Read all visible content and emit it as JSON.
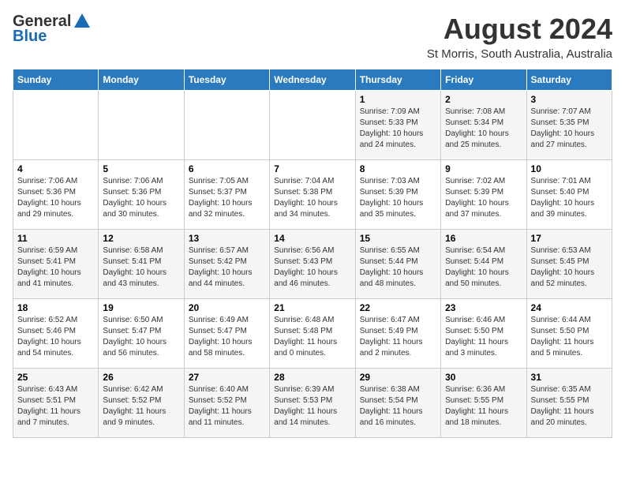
{
  "header": {
    "logo_general": "General",
    "logo_blue": "Blue",
    "month_year": "August 2024",
    "location": "St Morris, South Australia, Australia"
  },
  "days_of_week": [
    "Sunday",
    "Monday",
    "Tuesday",
    "Wednesday",
    "Thursday",
    "Friday",
    "Saturday"
  ],
  "weeks": [
    [
      {
        "day": "",
        "detail": ""
      },
      {
        "day": "",
        "detail": ""
      },
      {
        "day": "",
        "detail": ""
      },
      {
        "day": "",
        "detail": ""
      },
      {
        "day": "1",
        "detail": "Sunrise: 7:09 AM\nSunset: 5:33 PM\nDaylight: 10 hours\nand 24 minutes."
      },
      {
        "day": "2",
        "detail": "Sunrise: 7:08 AM\nSunset: 5:34 PM\nDaylight: 10 hours\nand 25 minutes."
      },
      {
        "day": "3",
        "detail": "Sunrise: 7:07 AM\nSunset: 5:35 PM\nDaylight: 10 hours\nand 27 minutes."
      }
    ],
    [
      {
        "day": "4",
        "detail": "Sunrise: 7:06 AM\nSunset: 5:36 PM\nDaylight: 10 hours\nand 29 minutes."
      },
      {
        "day": "5",
        "detail": "Sunrise: 7:06 AM\nSunset: 5:36 PM\nDaylight: 10 hours\nand 30 minutes."
      },
      {
        "day": "6",
        "detail": "Sunrise: 7:05 AM\nSunset: 5:37 PM\nDaylight: 10 hours\nand 32 minutes."
      },
      {
        "day": "7",
        "detail": "Sunrise: 7:04 AM\nSunset: 5:38 PM\nDaylight: 10 hours\nand 34 minutes."
      },
      {
        "day": "8",
        "detail": "Sunrise: 7:03 AM\nSunset: 5:39 PM\nDaylight: 10 hours\nand 35 minutes."
      },
      {
        "day": "9",
        "detail": "Sunrise: 7:02 AM\nSunset: 5:39 PM\nDaylight: 10 hours\nand 37 minutes."
      },
      {
        "day": "10",
        "detail": "Sunrise: 7:01 AM\nSunset: 5:40 PM\nDaylight: 10 hours\nand 39 minutes."
      }
    ],
    [
      {
        "day": "11",
        "detail": "Sunrise: 6:59 AM\nSunset: 5:41 PM\nDaylight: 10 hours\nand 41 minutes."
      },
      {
        "day": "12",
        "detail": "Sunrise: 6:58 AM\nSunset: 5:41 PM\nDaylight: 10 hours\nand 43 minutes."
      },
      {
        "day": "13",
        "detail": "Sunrise: 6:57 AM\nSunset: 5:42 PM\nDaylight: 10 hours\nand 44 minutes."
      },
      {
        "day": "14",
        "detail": "Sunrise: 6:56 AM\nSunset: 5:43 PM\nDaylight: 10 hours\nand 46 minutes."
      },
      {
        "day": "15",
        "detail": "Sunrise: 6:55 AM\nSunset: 5:44 PM\nDaylight: 10 hours\nand 48 minutes."
      },
      {
        "day": "16",
        "detail": "Sunrise: 6:54 AM\nSunset: 5:44 PM\nDaylight: 10 hours\nand 50 minutes."
      },
      {
        "day": "17",
        "detail": "Sunrise: 6:53 AM\nSunset: 5:45 PM\nDaylight: 10 hours\nand 52 minutes."
      }
    ],
    [
      {
        "day": "18",
        "detail": "Sunrise: 6:52 AM\nSunset: 5:46 PM\nDaylight: 10 hours\nand 54 minutes."
      },
      {
        "day": "19",
        "detail": "Sunrise: 6:50 AM\nSunset: 5:47 PM\nDaylight: 10 hours\nand 56 minutes."
      },
      {
        "day": "20",
        "detail": "Sunrise: 6:49 AM\nSunset: 5:47 PM\nDaylight: 10 hours\nand 58 minutes."
      },
      {
        "day": "21",
        "detail": "Sunrise: 6:48 AM\nSunset: 5:48 PM\nDaylight: 11 hours\nand 0 minutes."
      },
      {
        "day": "22",
        "detail": "Sunrise: 6:47 AM\nSunset: 5:49 PM\nDaylight: 11 hours\nand 2 minutes."
      },
      {
        "day": "23",
        "detail": "Sunrise: 6:46 AM\nSunset: 5:50 PM\nDaylight: 11 hours\nand 3 minutes."
      },
      {
        "day": "24",
        "detail": "Sunrise: 6:44 AM\nSunset: 5:50 PM\nDaylight: 11 hours\nand 5 minutes."
      }
    ],
    [
      {
        "day": "25",
        "detail": "Sunrise: 6:43 AM\nSunset: 5:51 PM\nDaylight: 11 hours\nand 7 minutes."
      },
      {
        "day": "26",
        "detail": "Sunrise: 6:42 AM\nSunset: 5:52 PM\nDaylight: 11 hours\nand 9 minutes."
      },
      {
        "day": "27",
        "detail": "Sunrise: 6:40 AM\nSunset: 5:52 PM\nDaylight: 11 hours\nand 11 minutes."
      },
      {
        "day": "28",
        "detail": "Sunrise: 6:39 AM\nSunset: 5:53 PM\nDaylight: 11 hours\nand 14 minutes."
      },
      {
        "day": "29",
        "detail": "Sunrise: 6:38 AM\nSunset: 5:54 PM\nDaylight: 11 hours\nand 16 minutes."
      },
      {
        "day": "30",
        "detail": "Sunrise: 6:36 AM\nSunset: 5:55 PM\nDaylight: 11 hours\nand 18 minutes."
      },
      {
        "day": "31",
        "detail": "Sunrise: 6:35 AM\nSunset: 5:55 PM\nDaylight: 11 hours\nand 20 minutes."
      }
    ]
  ]
}
